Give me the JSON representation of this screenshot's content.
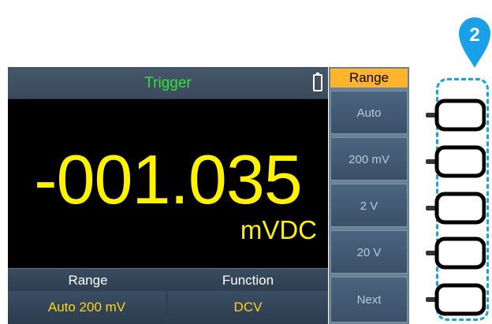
{
  "screen": {
    "title": "Trigger",
    "reading": "-001.035",
    "unit": "mVDC",
    "colors": {
      "title_text": "#35e03a",
      "reading_text": "#fff200",
      "softkey_highlight": "#ffb42b",
      "callout": "#1aa0e6"
    }
  },
  "info": {
    "headers": [
      "Range",
      "Function"
    ],
    "values": [
      "Auto 200 mV",
      "DCV"
    ]
  },
  "menu": {
    "title": "Range",
    "items": [
      "Auto",
      "200 mV",
      "2 V",
      "20 V",
      "Next"
    ]
  },
  "callout": {
    "number": "2"
  },
  "icons": {
    "battery": "battery-icon",
    "callout_marker": "map-pin-icon"
  }
}
